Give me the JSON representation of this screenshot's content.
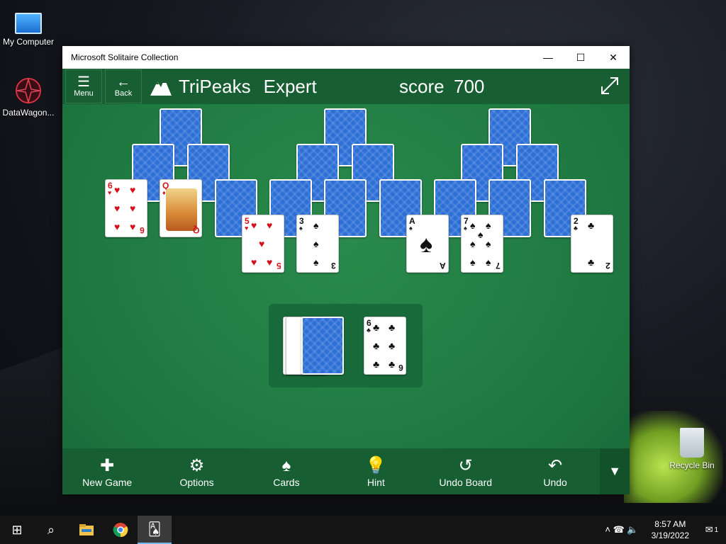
{
  "desktop": {
    "icons": [
      {
        "label": "My Computer"
      },
      {
        "label": "DataWagon..."
      },
      {
        "label": "Recycle Bin"
      }
    ]
  },
  "window": {
    "title": "Microsoft Solitaire Collection",
    "controls": {
      "minimize": "—",
      "maximize": "☐",
      "close": "✕"
    }
  },
  "game": {
    "menu_label": "Menu",
    "back_label": "Back",
    "menu_icon": "☰",
    "back_icon": "🠔",
    "name": "TriPeaks",
    "mode": "Expert",
    "score_label": "score",
    "score_value": "700",
    "expand_icon": "⤢"
  },
  "cards": {
    "row3_left": [
      {
        "rank": "6",
        "suit": "♥",
        "color": "red"
      },
      {
        "rank": "Q",
        "suit": "♦",
        "color": "red"
      }
    ],
    "row4": [
      {
        "rank": "5",
        "suit": "♥",
        "color": "red"
      },
      {
        "rank": "3",
        "suit": "♠",
        "color": "black"
      },
      {
        "rank": "A",
        "suit": "♠",
        "color": "black"
      },
      {
        "rank": "7",
        "suit": "♠",
        "color": "black"
      },
      {
        "rank": "2",
        "suit": "♣",
        "color": "black"
      }
    ],
    "waste": {
      "rank": "6",
      "suit": "♣",
      "color": "black"
    }
  },
  "toolbar": {
    "items": [
      {
        "label": "New Game",
        "icon": "✚"
      },
      {
        "label": "Options",
        "icon": "⚙"
      },
      {
        "label": "Cards",
        "icon": "♠"
      },
      {
        "label": "Hint",
        "icon": "💡"
      },
      {
        "label": "Undo Board",
        "icon": "↺"
      },
      {
        "label": "Undo",
        "icon": "↶"
      }
    ],
    "more_icon": "▼"
  },
  "taskbar": {
    "start_icon": "⊞",
    "search_icon": "⌕",
    "tray_icons": "˄ ☎ 🔈",
    "time": "8:57 AM",
    "date": "3/19/2022",
    "notif_count": "1"
  }
}
